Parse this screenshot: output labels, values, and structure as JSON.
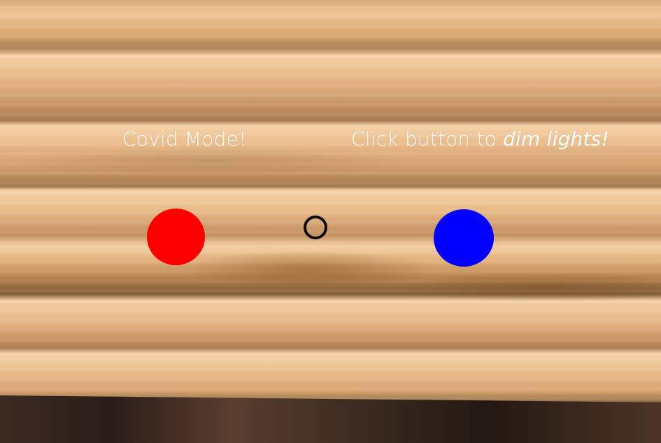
{
  "scene": {
    "left_label": "Covid Mode!",
    "right_label": {
      "prefix": "Click button to ",
      "emphasis": "dim lights!"
    }
  },
  "buttons": {
    "left": {
      "icon": "circle",
      "color": "#ff0000"
    },
    "right": {
      "icon": "circle",
      "color": "#0000ff"
    }
  },
  "cursor": {
    "icon": "ring-cursor",
    "color": "#0b0b0b"
  },
  "colors": {
    "text": "#ffffff",
    "wood_light": "#f6d0a3",
    "wood_mid": "#e6b784",
    "wood_dark": "#a57a4f"
  }
}
